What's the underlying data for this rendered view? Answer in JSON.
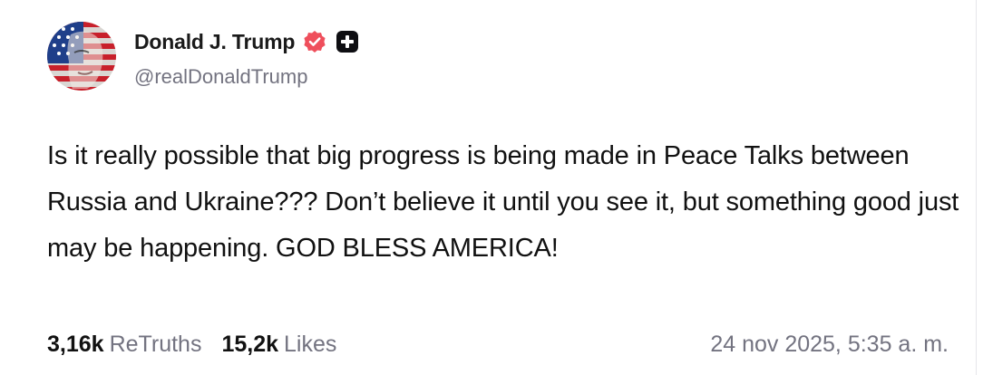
{
  "author": {
    "display_name": "Donald J. Trump",
    "handle": "@realDonaldTrump",
    "avatar_icon": "flag-face-avatar",
    "verified_icon": "verified-badge-icon",
    "plus_icon": "plus-badge-icon",
    "verified_color": "#ef4f5c"
  },
  "post": {
    "text": "Is it really possible that big progress is being made in Peace Talks between Russia and Ukraine??? Don’t believe it until you see it, but something good just may be happening. GOD BLESS AMERICA!"
  },
  "stats": {
    "retruths_count": "3,16k",
    "retruths_label": "ReTruths",
    "likes_count": "15,2k",
    "likes_label": "Likes",
    "timestamp": "24 nov 2025, 5:35 a. m."
  }
}
